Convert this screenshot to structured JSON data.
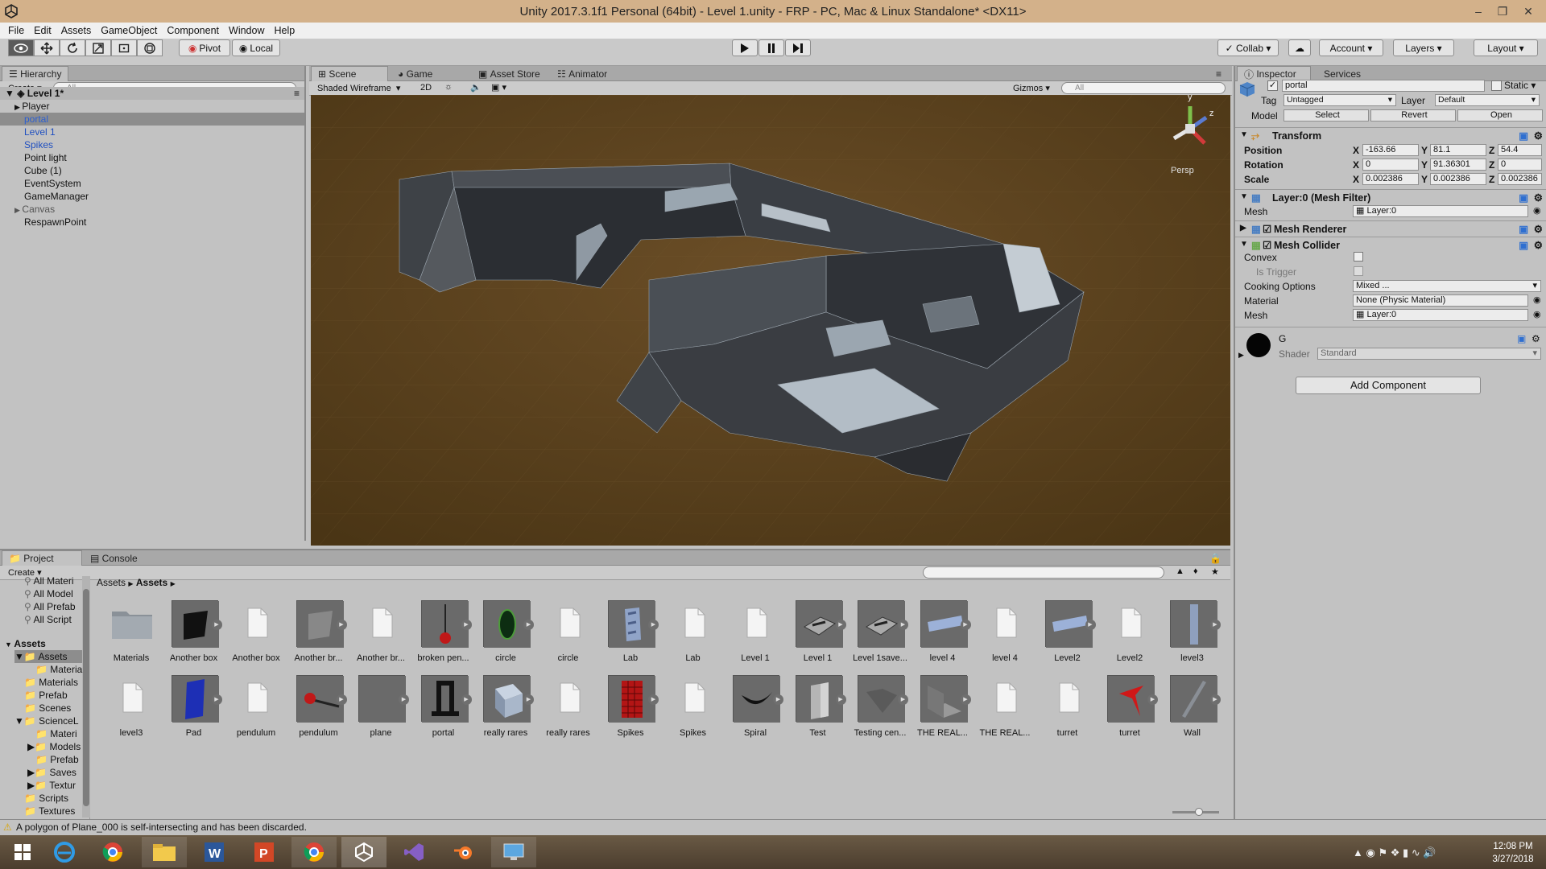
{
  "window": {
    "title": "Unity 2017.3.1f1 Personal (64bit) - Level 1.unity - FRP - PC, Mac & Linux Standalone* <DX11>"
  },
  "menu": [
    "File",
    "Edit",
    "Assets",
    "GameObject",
    "Component",
    "Window",
    "Help"
  ],
  "toolbar": {
    "pivot": "Pivot",
    "local": "Local",
    "collab": "Collab",
    "account": "Account",
    "layers": "Layers",
    "layout": "Layout"
  },
  "hierarchy": {
    "tab": "Hierarchy",
    "create": "Create",
    "search_placeholder": "All",
    "scene": "Level 1*",
    "items": [
      "Player",
      "portal",
      "Level 1",
      "Spikes",
      "Point light",
      "Cube (1)",
      "EventSystem",
      "GameManager",
      "Canvas",
      "RespawnPoint"
    ]
  },
  "scene": {
    "tabs": [
      "Scene",
      "Game",
      "Asset Store",
      "Animator"
    ],
    "shading": "Shaded Wireframe",
    "mode_2d": "2D",
    "gizmos": "Gizmos",
    "search_placeholder": "All",
    "persp": "Persp",
    "axis_y": "y",
    "axis_z": "z"
  },
  "inspector": {
    "tabs": [
      "Inspector",
      "Services"
    ],
    "object_name": "portal",
    "static_label": "Static",
    "tag_label": "Tag",
    "tag_value": "Untagged",
    "layer_label": "Layer",
    "layer_value": "Default",
    "model_label": "Model",
    "model_buttons": [
      "Select",
      "Revert",
      "Open"
    ],
    "transform": {
      "title": "Transform",
      "position_label": "Position",
      "rotation_label": "Rotation",
      "scale_label": "Scale",
      "position": {
        "x": "-163.66",
        "y": "81.1",
        "z": "54.4"
      },
      "rotation": {
        "x": "0",
        "y": "91.36301",
        "z": "0"
      },
      "scale": {
        "x": "0.002386",
        "y": "0.002386",
        "z": "0.002386"
      }
    },
    "mesh_filter": {
      "title": "Layer:0 (Mesh Filter)",
      "mesh_label": "Mesh",
      "mesh_value": "Layer:0"
    },
    "mesh_renderer": {
      "title": "Mesh Renderer"
    },
    "mesh_collider": {
      "title": "Mesh Collider",
      "convex": "Convex",
      "is_trigger": "Is Trigger",
      "cooking_label": "Cooking Options",
      "cooking_value": "Mixed ...",
      "material_label": "Material",
      "material_value": "None (Physic Material)",
      "mesh_label": "Mesh",
      "mesh_value": "Layer:0"
    },
    "material": {
      "name": "G",
      "shader_label": "Shader",
      "shader_value": "Standard"
    },
    "add_component": "Add Component",
    "axis_x": "X",
    "axis_y": "Y",
    "axis_z": "Z"
  },
  "project": {
    "tabs": [
      "Project",
      "Console"
    ],
    "create": "Create",
    "breadcrumb": [
      "Assets",
      "Assets"
    ],
    "favorites": [
      "All Materi",
      "All Model",
      "All Prefab",
      "All Script"
    ],
    "tree": [
      "Assets",
      "Assets",
      "Materia",
      "Materials",
      "Prefab",
      "Scenes",
      "ScienceL",
      "Materi",
      "Models",
      "Prefab",
      "Saves",
      "Textur",
      "Scripts",
      "Textures"
    ],
    "assets_row1": [
      "Materials",
      "Another box",
      "Another box",
      "Another br...",
      "Another br...",
      "broken pen...",
      "circle",
      "circle",
      "Lab",
      "Lab",
      "Level 1",
      "Level 1",
      "Level 1save...",
      "level 4",
      "level 4",
      "Level2",
      "Level2",
      "level3"
    ],
    "assets_row2": [
      "level3",
      "Pad",
      "pendulum",
      "pendulum",
      "plane",
      "portal",
      "really rares",
      "really rares",
      "Spikes",
      "Spikes",
      "Spiral",
      "Test",
      "Testing cen...",
      "THE REAL...",
      "THE REAL...",
      "turret",
      "turret",
      "Wall"
    ]
  },
  "status": "A polygon of Plane_000 is self-intersecting and has been discarded.",
  "clock": {
    "time": "12:08 PM",
    "date": "3/27/2018"
  }
}
